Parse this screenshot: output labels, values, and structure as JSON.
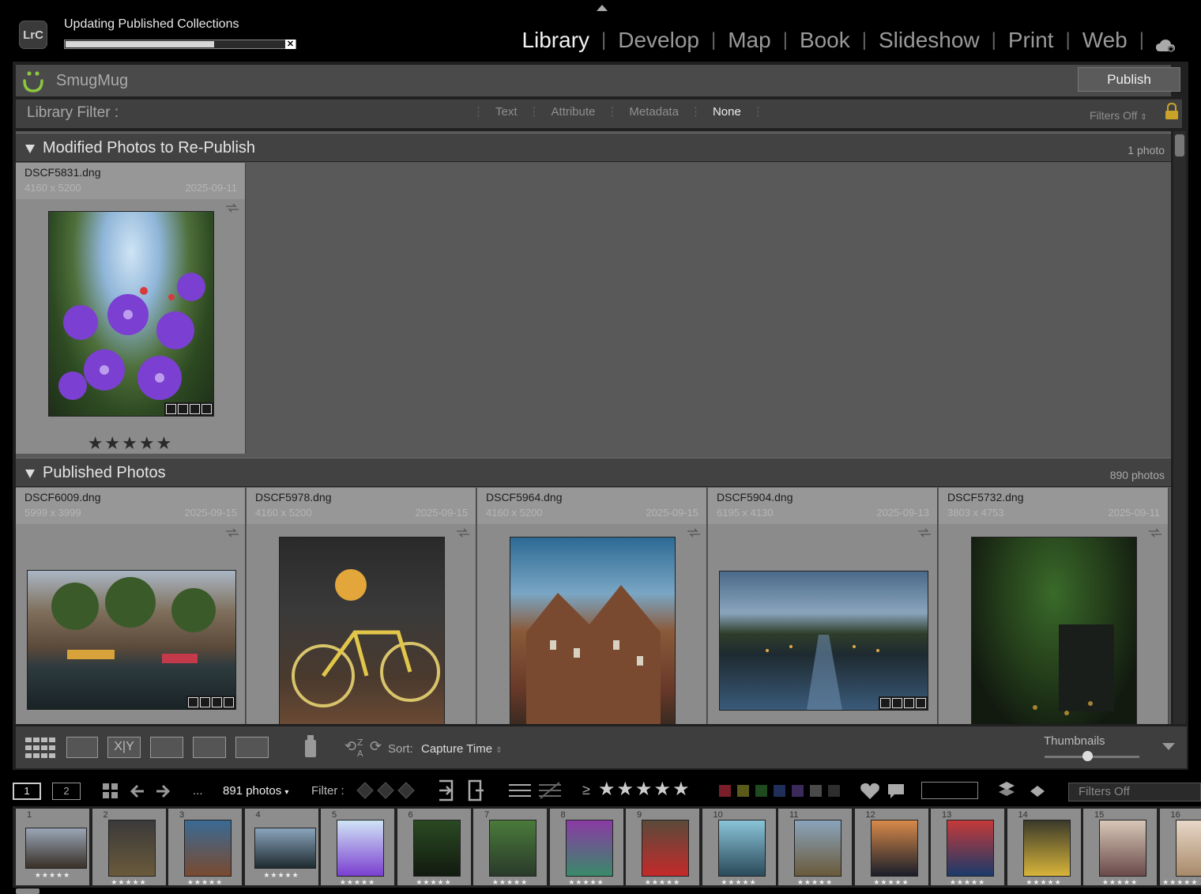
{
  "app": {
    "logo_text": "LrC"
  },
  "activity": {
    "title": "Updating Published Collections",
    "progress": 0.67,
    "cancel_label": "✕"
  },
  "modules": [
    "Library",
    "Develop",
    "Map",
    "Book",
    "Slideshow",
    "Print",
    "Web"
  ],
  "active_module": "Library",
  "publish_service": {
    "name": "SmugMug",
    "publish_label": "Publish"
  },
  "library_filter": {
    "label": "Library Filter :",
    "options": [
      "Text",
      "Attribute",
      "Metadata",
      "None"
    ],
    "active": "None",
    "status": "Filters Off"
  },
  "sections": [
    {
      "title": "Modified Photos to Re-Publish",
      "count": "1 photo",
      "photos": [
        {
          "filename": "DSCF5831.dng",
          "dims": "4160 x 5200",
          "date": "2025-09-11",
          "stars": "★★★★★"
        }
      ]
    },
    {
      "title": "Published Photos",
      "count": "890 photos",
      "photos": [
        {
          "filename": "DSCF6009.dng",
          "dims": "5999 x 3999",
          "date": "2025-09-15"
        },
        {
          "filename": "DSCF5978.dng",
          "dims": "4160 x 5200",
          "date": "2025-09-15"
        },
        {
          "filename": "DSCF5964.dng",
          "dims": "4160 x 5200",
          "date": "2025-09-15"
        },
        {
          "filename": "DSCF5904.dng",
          "dims": "6195 x 4130",
          "date": "2025-09-13"
        },
        {
          "filename": "DSCF5732.dng",
          "dims": "3803 x 4753",
          "date": "2025-09-11"
        }
      ]
    }
  ],
  "toolbar": {
    "sort_label": "Sort:",
    "sort_value": "Capture Time",
    "thumbnails_label": "Thumbnails",
    "thumbnail_size": 0.45
  },
  "filmstrip_bar": {
    "screen1": "1",
    "screen2": "2",
    "ellipsis": "...",
    "photo_count": "891 photos",
    "filter_label": "Filter :",
    "rating_op": "≥",
    "rating_stars": "★★★★★",
    "filters_off": "Filters Off",
    "color_labels": [
      "#7a1f2a",
      "#5a5a1a",
      "#1f4a1f",
      "#1f2f5a",
      "#3a2a5a",
      "#4a4a4a",
      "#2e2e2e"
    ]
  },
  "filmstrip": {
    "numbers": [
      "1",
      "2",
      "3",
      "4",
      "5",
      "6",
      "7",
      "8",
      "9",
      "10",
      "11",
      "12",
      "13",
      "14",
      "15",
      "16"
    ],
    "stars": "★★★★★"
  }
}
